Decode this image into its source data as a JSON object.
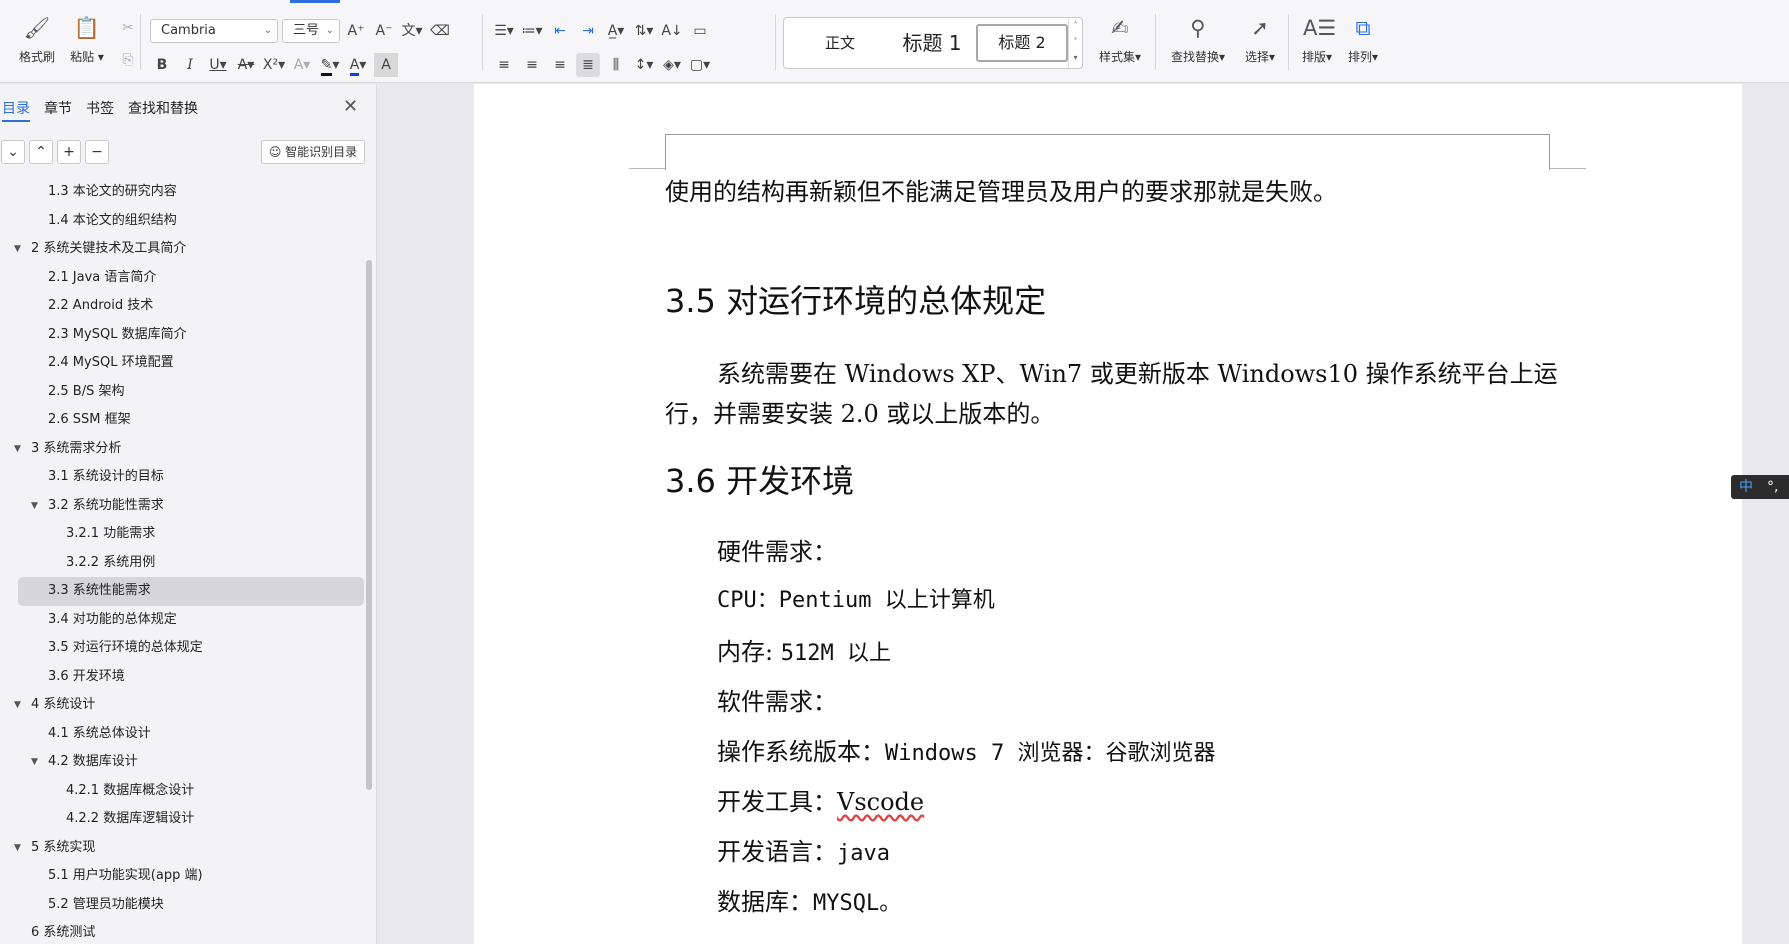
{
  "ribbon": {
    "format_painter": "格式刷",
    "paste": "粘贴",
    "font_name": "Cambria",
    "font_size": "三号",
    "styles": [
      "正文",
      "标题 1",
      "标题 2"
    ],
    "style_set": "样式集",
    "find_replace": "查找替换",
    "select": "选择",
    "typeset": "排版",
    "arrange": "排列",
    "bold": "B",
    "italic": "I",
    "underline": "U",
    "strike": "A",
    "superscript": "X²",
    "font_color": "A",
    "char_shade": "A"
  },
  "nav": {
    "tabs": [
      "目录",
      "章节",
      "书签",
      "查找和替换"
    ],
    "smart_toc": "智能识别目录",
    "items": [
      {
        "text": "1.3 本论文的研究内容",
        "level": 2,
        "expandable": false
      },
      {
        "text": "1.4 本论文的组织结构",
        "level": 2,
        "expandable": false
      },
      {
        "text": "2 系统关键技术及工具简介",
        "level": 1,
        "expandable": true
      },
      {
        "text": "2.1 Java 语言简介",
        "level": 2,
        "expandable": false
      },
      {
        "text": "2.2 Android 技术",
        "level": 2,
        "expandable": false
      },
      {
        "text": "2.3 MySQL 数据库简介",
        "level": 2,
        "expandable": false
      },
      {
        "text": "2.4 MySQL 环境配置",
        "level": 2,
        "expandable": false
      },
      {
        "text": "2.5 B/S 架构",
        "level": 2,
        "expandable": false
      },
      {
        "text": "2.6 SSM 框架",
        "level": 2,
        "expandable": false
      },
      {
        "text": "3 系统需求分析",
        "level": 1,
        "expandable": true
      },
      {
        "text": "3.1 系统设计的目标",
        "level": 2,
        "expandable": false
      },
      {
        "text": "3.2 系统功能性需求",
        "level": 2,
        "expandable": true
      },
      {
        "text": "3.2.1 功能需求",
        "level": 3,
        "expandable": false
      },
      {
        "text": "3.2.2 系统用例",
        "level": 3,
        "expandable": false
      },
      {
        "text": "3.3 系统性能需求",
        "level": 2,
        "expandable": false,
        "selected": true
      },
      {
        "text": "3.4 对功能的总体规定",
        "level": 2,
        "expandable": false
      },
      {
        "text": "3.5 对运行环境的总体规定",
        "level": 2,
        "expandable": false
      },
      {
        "text": "3.6 开发环境",
        "level": 2,
        "expandable": false
      },
      {
        "text": "4 系统设计",
        "level": 1,
        "expandable": true
      },
      {
        "text": "4.1 系统总体设计",
        "level": 2,
        "expandable": false
      },
      {
        "text": "4.2 数据库设计",
        "level": 2,
        "expandable": true
      },
      {
        "text": "4.2.1 数据库概念设计",
        "level": 3,
        "expandable": false
      },
      {
        "text": "4.2.2 数据库逻辑设计",
        "level": 3,
        "expandable": false
      },
      {
        "text": "5 系统实现",
        "level": 1,
        "expandable": true
      },
      {
        "text": "5.1 用户功能实现(app 端)",
        "level": 2,
        "expandable": false
      },
      {
        "text": "5.2 管理员功能模块",
        "level": 2,
        "expandable": false
      },
      {
        "text": "6 系统测试",
        "level": 1,
        "expandable": false
      }
    ]
  },
  "doc": {
    "para_top": "使用的结构再新颖但不能满足管理员及用户的要求那就是失败。",
    "h35": "3.5 对运行环境的总体规定",
    "p35_line1": "系统需要在 Windows XP、Win7 或更新版本 Windows10 操作系统平台上运",
    "p35_line2": "行，并需要安装 2.0 或以上版本的。",
    "h36": "3.6 开发环境",
    "hw_label": "硬件需求：",
    "cpu_label": "CPU：",
    "cpu_value": "Pentium 以上计算机",
    "mem_label": "内存:",
    "mem_value": "512M 以上",
    "sw_label": "软件需求：",
    "os_label": "操作系统版本：",
    "os_value": "Windows 7 浏览器：谷歌浏览器",
    "tool_label": "开发工具：",
    "tool_value": "Vscode",
    "lang_label": "开发语言：",
    "lang_value": "java",
    "db_label": "数据库：",
    "db_value": "MYSQL。"
  },
  "ime": {
    "mode": "中",
    "punct": "°,"
  }
}
